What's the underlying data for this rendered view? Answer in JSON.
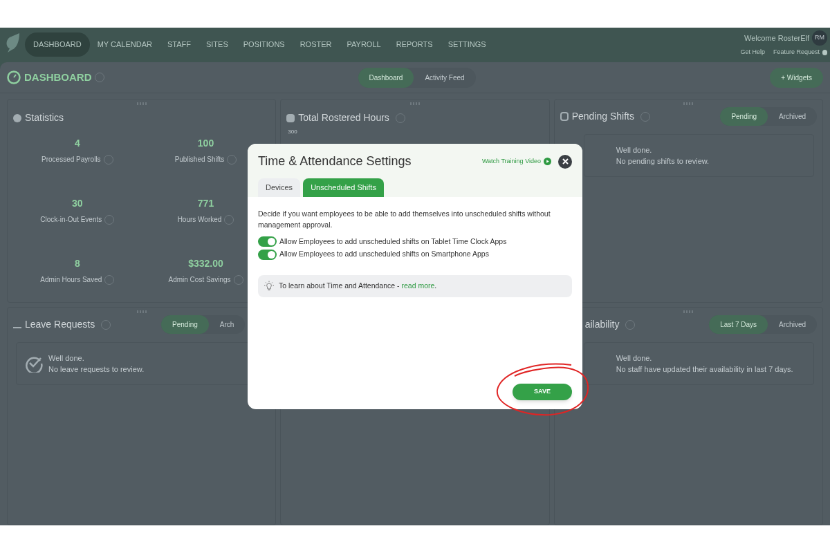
{
  "nav": {
    "items": [
      {
        "label": "DASHBOARD",
        "selected": true
      },
      {
        "label": "MY CALENDAR",
        "selected": false
      },
      {
        "label": "STAFF",
        "selected": false
      },
      {
        "label": "SITES",
        "selected": false
      },
      {
        "label": "POSITIONS",
        "selected": false
      },
      {
        "label": "ROSTER",
        "selected": false
      },
      {
        "label": "PAYROLL",
        "selected": false
      },
      {
        "label": "REPORTS",
        "selected": false
      },
      {
        "label": "SETTINGS",
        "selected": false
      }
    ],
    "welcome": "Welcome RosterElf",
    "avatar": "RM",
    "links": [
      "Get Help",
      "Feature Request"
    ]
  },
  "dashboard": {
    "title": "DASHBOARD",
    "views": [
      {
        "label": "Dashboard",
        "selected": true
      },
      {
        "label": "Activity Feed",
        "selected": false
      }
    ],
    "widgets_button": "+ Widgets"
  },
  "statistics": {
    "title": "Statistics",
    "stats": [
      {
        "value": "4",
        "label": "Processed Payrolls"
      },
      {
        "value": "100",
        "label": "Published Shifts"
      },
      {
        "value": "30",
        "label": "Clock-in-Out Events"
      },
      {
        "value": "771",
        "label": "Hours Worked"
      },
      {
        "value": "8",
        "label": "Admin Hours Saved"
      },
      {
        "value": "$332.00",
        "label": "Admin Cost Savings"
      }
    ]
  },
  "total_hours": {
    "title": "Total Rostered Hours",
    "axis_label": "300"
  },
  "pending_shifts": {
    "title": "Pending Shifts",
    "filters": [
      {
        "label": "Pending",
        "selected": true
      },
      {
        "label": "Archived",
        "selected": false
      }
    ],
    "message": [
      "Well done.",
      "No pending shifts to review."
    ]
  },
  "leave_requests": {
    "title": "Leave Requests",
    "filters": [
      {
        "label": "Pending",
        "selected": true
      },
      {
        "label": "Arch",
        "selected": false
      }
    ],
    "message": [
      "Well done.",
      "No leave requests to review."
    ]
  },
  "availability": {
    "title": "ailability",
    "filters": [
      {
        "label": "Last 7 Days",
        "selected": true
      },
      {
        "label": "Archived",
        "selected": false
      }
    ],
    "message": [
      "Well done.",
      "No staff have updated their availability in last 7 days."
    ]
  },
  "modal": {
    "title": "Time & Attendance Settings",
    "video_link": "Watch Training Video",
    "tabs": [
      {
        "label": "Devices",
        "selected": false
      },
      {
        "label": "Unscheduled Shifts",
        "selected": true
      }
    ],
    "description": "Decide if you want employees to be able to add themselves into unscheduled shifts without management approval.",
    "toggles": [
      {
        "label": "Allow Employees to add unscheduled shifts on Tablet Time Clock Apps",
        "on": true
      },
      {
        "label": "Allow Employees to add unscheduled shifts on Smartphone Apps",
        "on": true
      }
    ],
    "tip": {
      "text": "To learn about Time and Attendance - ",
      "link": "read more",
      "end": "."
    },
    "save_button": "SAVE"
  }
}
